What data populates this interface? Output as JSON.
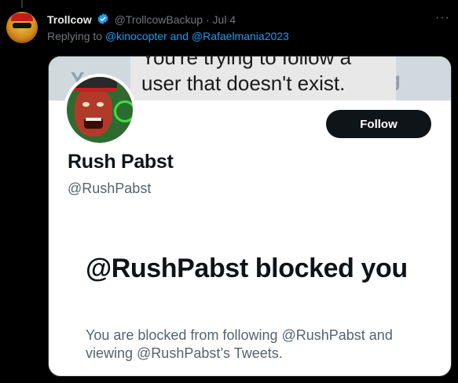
{
  "tweet": {
    "author_name": "Trollcow",
    "author_handle": "@TrollcowBackup",
    "separator": "·",
    "date": "Jul 4",
    "replying_prefix": "Replying to",
    "replying_to": "@kinocopter and @Rafaelmania2023",
    "more_label": "···"
  },
  "card": {
    "banner_line1": "You're trying to follow a",
    "banner_line2": "user that doesn't exist.",
    "banner_edge_left": "Y",
    "banner_edge_right": "g",
    "follow_label": "Follow",
    "profile_name": "Rush Pabst",
    "profile_handle": "@RushPabst",
    "blocked_title": "@RushPabst blocked you",
    "blocked_description": "You are blocked from following @RushPabst and viewing @RushPabst’s Tweets."
  },
  "colors": {
    "background": "#000000",
    "link": "#1d9bf0",
    "muted": "#71767b",
    "verified": "#1d9bf0",
    "follow_button": "#0f1419"
  },
  "icons": {
    "verified": "verified-badge-icon",
    "more": "more-icon"
  }
}
